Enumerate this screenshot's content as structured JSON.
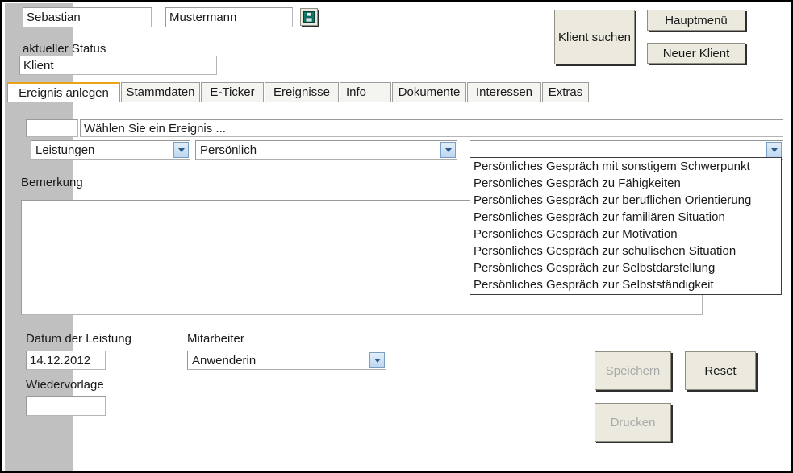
{
  "client": {
    "first_name": "Sebastian",
    "last_name": "Mustermann",
    "save_icon": "floppy-disk-icon",
    "status_label": "aktueller Status",
    "status_value": "Klient"
  },
  "header_buttons": {
    "search_client": "Klient suchen",
    "main_menu": "Hauptmenü",
    "new_client": "Neuer Klient"
  },
  "tabs": [
    {
      "label": "Ereignis anlegen",
      "active": true
    },
    {
      "label": "Stammdaten",
      "active": false
    },
    {
      "label": "E-Ticker",
      "active": false
    },
    {
      "label": "Ereignisse",
      "active": false
    },
    {
      "label": "Info",
      "active": false
    },
    {
      "label": "Dokumente",
      "active": false
    },
    {
      "label": "Interessen",
      "active": false
    },
    {
      "label": "Extras",
      "active": false
    }
  ],
  "event_form": {
    "code_field_value": "",
    "event_title": "Wählen Sie ein Ereignis ...",
    "category_value": "Leistungen",
    "subcategory_value": "Persönlich",
    "detail_value": "",
    "remark_label": "Bemerkung",
    "remark_value": ""
  },
  "dropdown_options": [
    "Persönliches Gespräch mit sonstigem Schwerpunkt",
    "Persönliches Gespräch zu Fähigkeiten",
    "Persönliches Gespräch zur beruflichen Orientierung",
    "Persönliches Gespräch zur familiären Situation",
    "Persönliches Gespräch zur Motivation",
    "Persönliches Gespräch zur schulischen Situation",
    "Persönliches Gespräch zur Selbstdarstellung",
    "Persönliches Gespräch zur Selbstständigkeit"
  ],
  "bottom_form": {
    "date_label": "Datum der Leistung",
    "date_value": "14.12.2012",
    "resubmit_label": "Wiedervorlage",
    "resubmit_value": "",
    "employee_label": "Mitarbeiter",
    "employee_value": "Anwenderin"
  },
  "action_buttons": {
    "save": "Speichern",
    "reset": "Reset",
    "print": "Drucken"
  },
  "colors": {
    "accent_tab": "#e8a317",
    "button_face": "#eceade",
    "rail": "#c0c0c0",
    "floppy": "#0d7a6a"
  }
}
